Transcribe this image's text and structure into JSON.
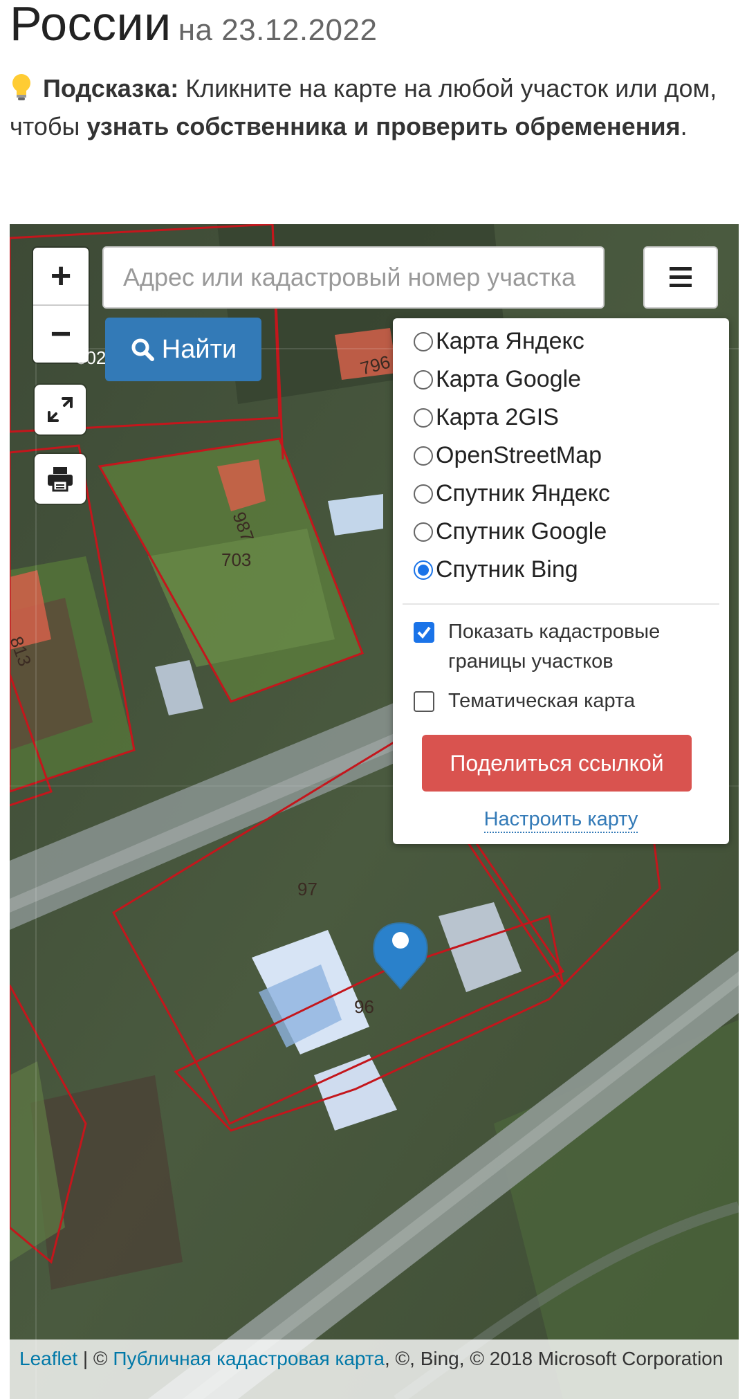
{
  "header": {
    "title": "России",
    "date": "на 23.12.2022"
  },
  "hint": {
    "icon": "lightbulb-icon",
    "label": "Подсказка:",
    "text1": " Кликните на карте на любой участок или дом, чтобы ",
    "bold": "узнать собственника и проверить обременения",
    "end": "."
  },
  "map": {
    "zoom_in": "+",
    "zoom_out": "−",
    "search_placeholder": "Адрес или кадастровый номер участка",
    "find_label": "Найти",
    "layers": [
      {
        "label": "Карта Яндекс",
        "selected": false
      },
      {
        "label": "Карта Google",
        "selected": false
      },
      {
        "label": "Карта 2GIS",
        "selected": false
      },
      {
        "label": "OpenStreetMap",
        "selected": false
      },
      {
        "label": "Спутник Яндекс",
        "selected": false
      },
      {
        "label": "Спутник Google",
        "selected": false
      },
      {
        "label": "Спутник Bing",
        "selected": true
      }
    ],
    "show_borders_label": "Показать кадастровые границы участков",
    "show_borders_checked": true,
    "thematic_label": "Тематическая карта",
    "thematic_checked": false,
    "share_label": "Поделиться ссылкой",
    "setup_label": "Настроить карту",
    "parcel_numbers": [
      "302",
      "796",
      "987",
      "703",
      "813",
      "97",
      "96"
    ],
    "colors": {
      "boundary": "#c4161c",
      "button_primary": "#337ab7",
      "button_danger": "#d9534f",
      "marker": "#2a81cb"
    }
  },
  "attribution": {
    "leaflet": "Leaflet",
    "sep1": " | © ",
    "pkk": "Публичная кадастровая карта",
    "rest": ", ©, Bing, © 2018 Microsoft Corporation"
  }
}
